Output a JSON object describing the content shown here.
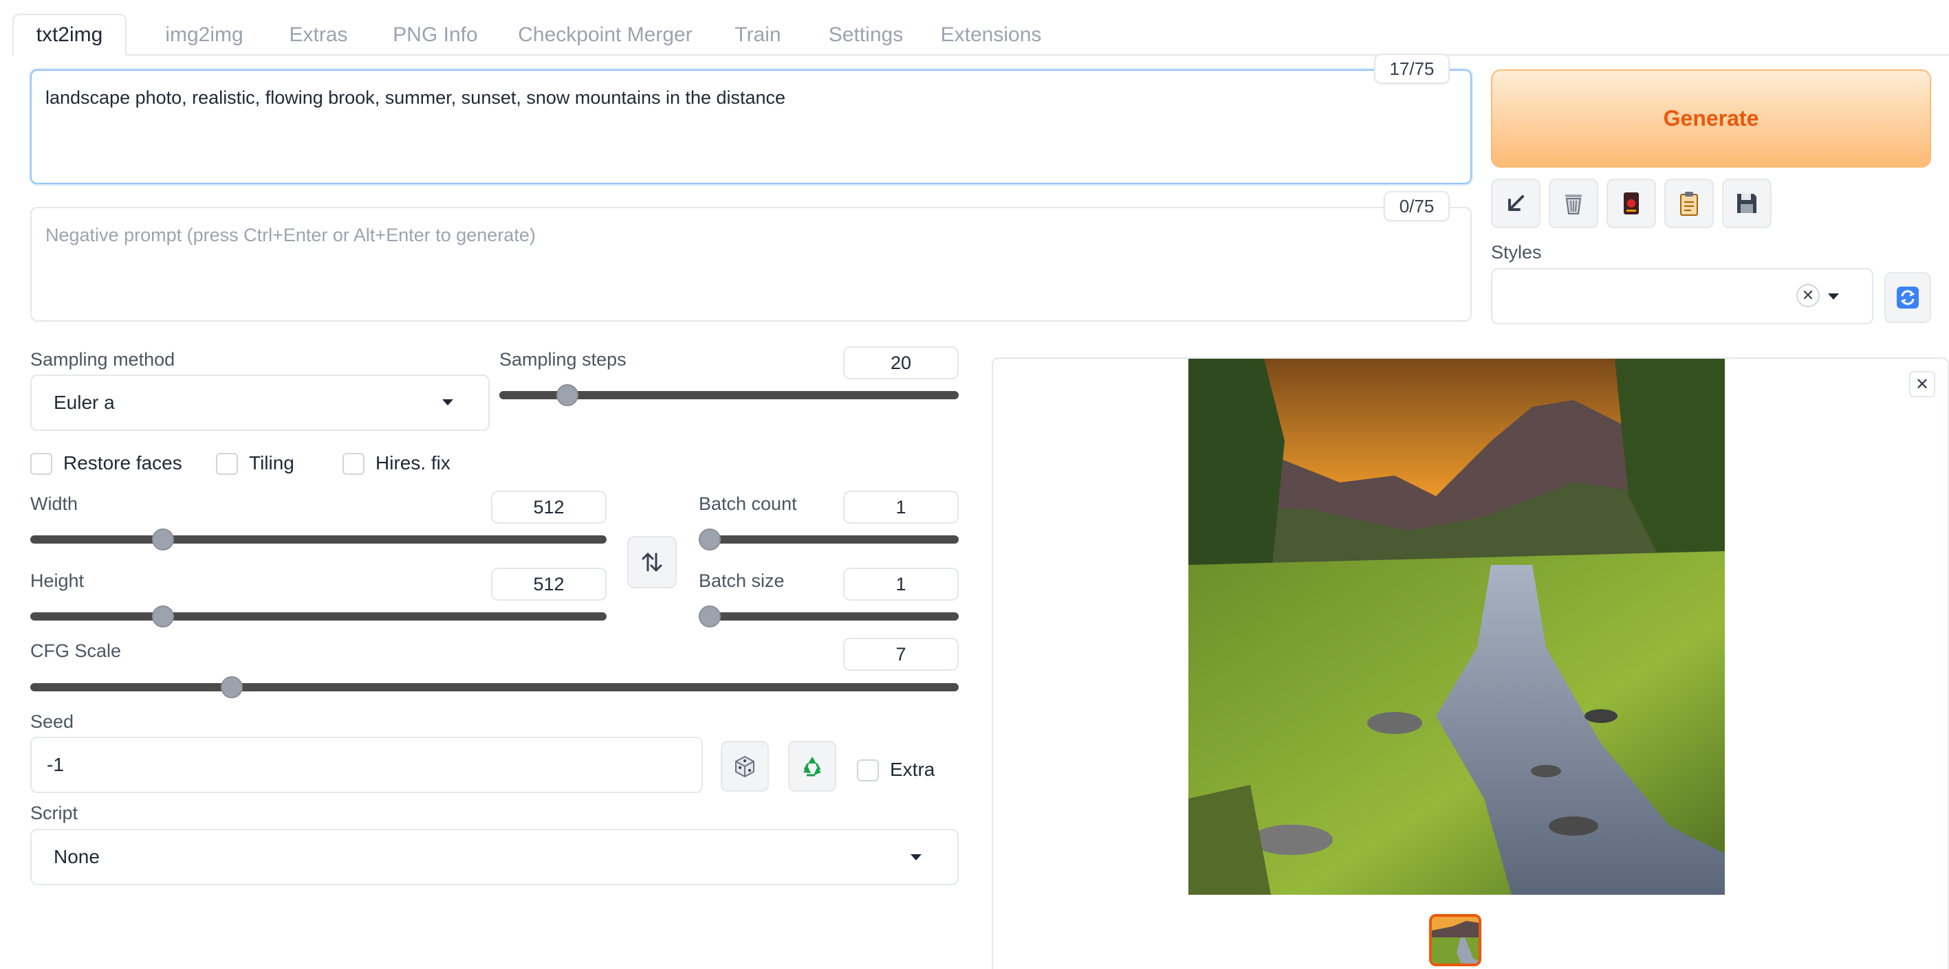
{
  "tabs": [
    {
      "label": "txt2img",
      "active": true
    },
    {
      "label": "img2img"
    },
    {
      "label": "Extras"
    },
    {
      "label": "PNG Info"
    },
    {
      "label": "Checkpoint Merger"
    },
    {
      "label": "Train"
    },
    {
      "label": "Settings"
    },
    {
      "label": "Extensions"
    }
  ],
  "prompt": {
    "value": "landscape photo, realistic, flowing brook, summer, sunset, snow mountains in the distance",
    "counter": "17/75"
  },
  "negative_prompt": {
    "placeholder": "Negative prompt (press Ctrl+Enter or Alt+Enter to generate)",
    "counter": "0/75"
  },
  "generate": {
    "label": "Generate"
  },
  "styles": {
    "label": "Styles",
    "value": ""
  },
  "sampling": {
    "method_label": "Sampling method",
    "method_value": "Euler a",
    "steps_label": "Sampling steps",
    "steps_value": "20",
    "steps_level": 0.13
  },
  "checkboxes": {
    "restore_faces": "Restore faces",
    "tiling": "Tiling",
    "hires_fix": "Hires. fix",
    "extra": "Extra"
  },
  "width": {
    "label": "Width",
    "value": "512",
    "level": 0.22
  },
  "height": {
    "label": "Height",
    "value": "512",
    "level": 0.22
  },
  "batch_count": {
    "label": "Batch count",
    "value": "1",
    "level": 0
  },
  "batch_size": {
    "label": "Batch size",
    "value": "1",
    "level": 0
  },
  "cfg": {
    "label": "CFG Scale",
    "value": "7",
    "level": 0.21
  },
  "seed": {
    "label": "Seed",
    "value": "-1"
  },
  "script": {
    "label": "Script",
    "value": "None"
  },
  "colors": {
    "accent": "#ea580c",
    "generate_bg": "#fdba74",
    "focus": "#93c5fd"
  },
  "icons": {
    "paste": "arrow-down-left-icon",
    "clear": "trash-icon",
    "extra_networks": "card-icon",
    "apply_style": "clipboard-icon",
    "save_style": "floppy-icon",
    "refresh": "refresh-icon",
    "swap": "swap-icon",
    "dice": "dice-icon",
    "recycle": "recycle-icon"
  }
}
